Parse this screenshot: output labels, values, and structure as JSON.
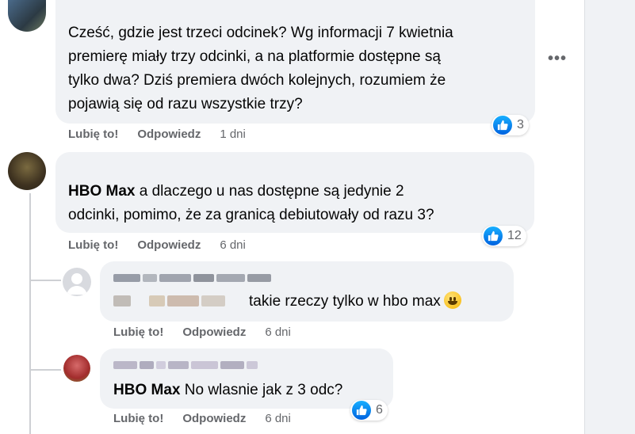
{
  "colors": {
    "bubble": "#f0f2f5",
    "like_blue": "#0866ff",
    "meta_gray": "#65676b"
  },
  "comments": [
    {
      "text_lines": [
        "Cześć, gdzie jest trzeci odcinek? Wg informacji 7 kwietnia",
        "premierę miały trzy odcinki, a na platformie dostępne są",
        "tylko dwa? Dziś premiera dwóch kolejnych, rozumiem że",
        "pojawią się od razu wszystkie trzy?"
      ],
      "like_label": "Lubię to!",
      "reply_label": "Odpowiedz",
      "time": "1 dni",
      "reaction_count": "3",
      "more_icon": "•••"
    },
    {
      "mention": "HBO Max",
      "text_line1": " a dlaczego u nas dostępne są jedynie 2",
      "text_line2": "odcinki, pomimo, że za granicą debiutowały od razu 3?",
      "like_label": "Lubię to!",
      "reply_label": "Odpowiedz",
      "time": "6 dni",
      "reaction_count": "12"
    }
  ],
  "replies": [
    {
      "text": "takie rzeczy tylko w hbo max",
      "emoji": "grinning-face",
      "like_label": "Lubię to!",
      "reply_label": "Odpowiedz",
      "time": "6 dni"
    },
    {
      "mention": "HBO Max",
      "text": " No wlasnie jak z 3 odc?",
      "like_label": "Lubię to!",
      "reply_label": "Odpowiedz",
      "time": "6 dni",
      "reaction_count": "6"
    }
  ]
}
